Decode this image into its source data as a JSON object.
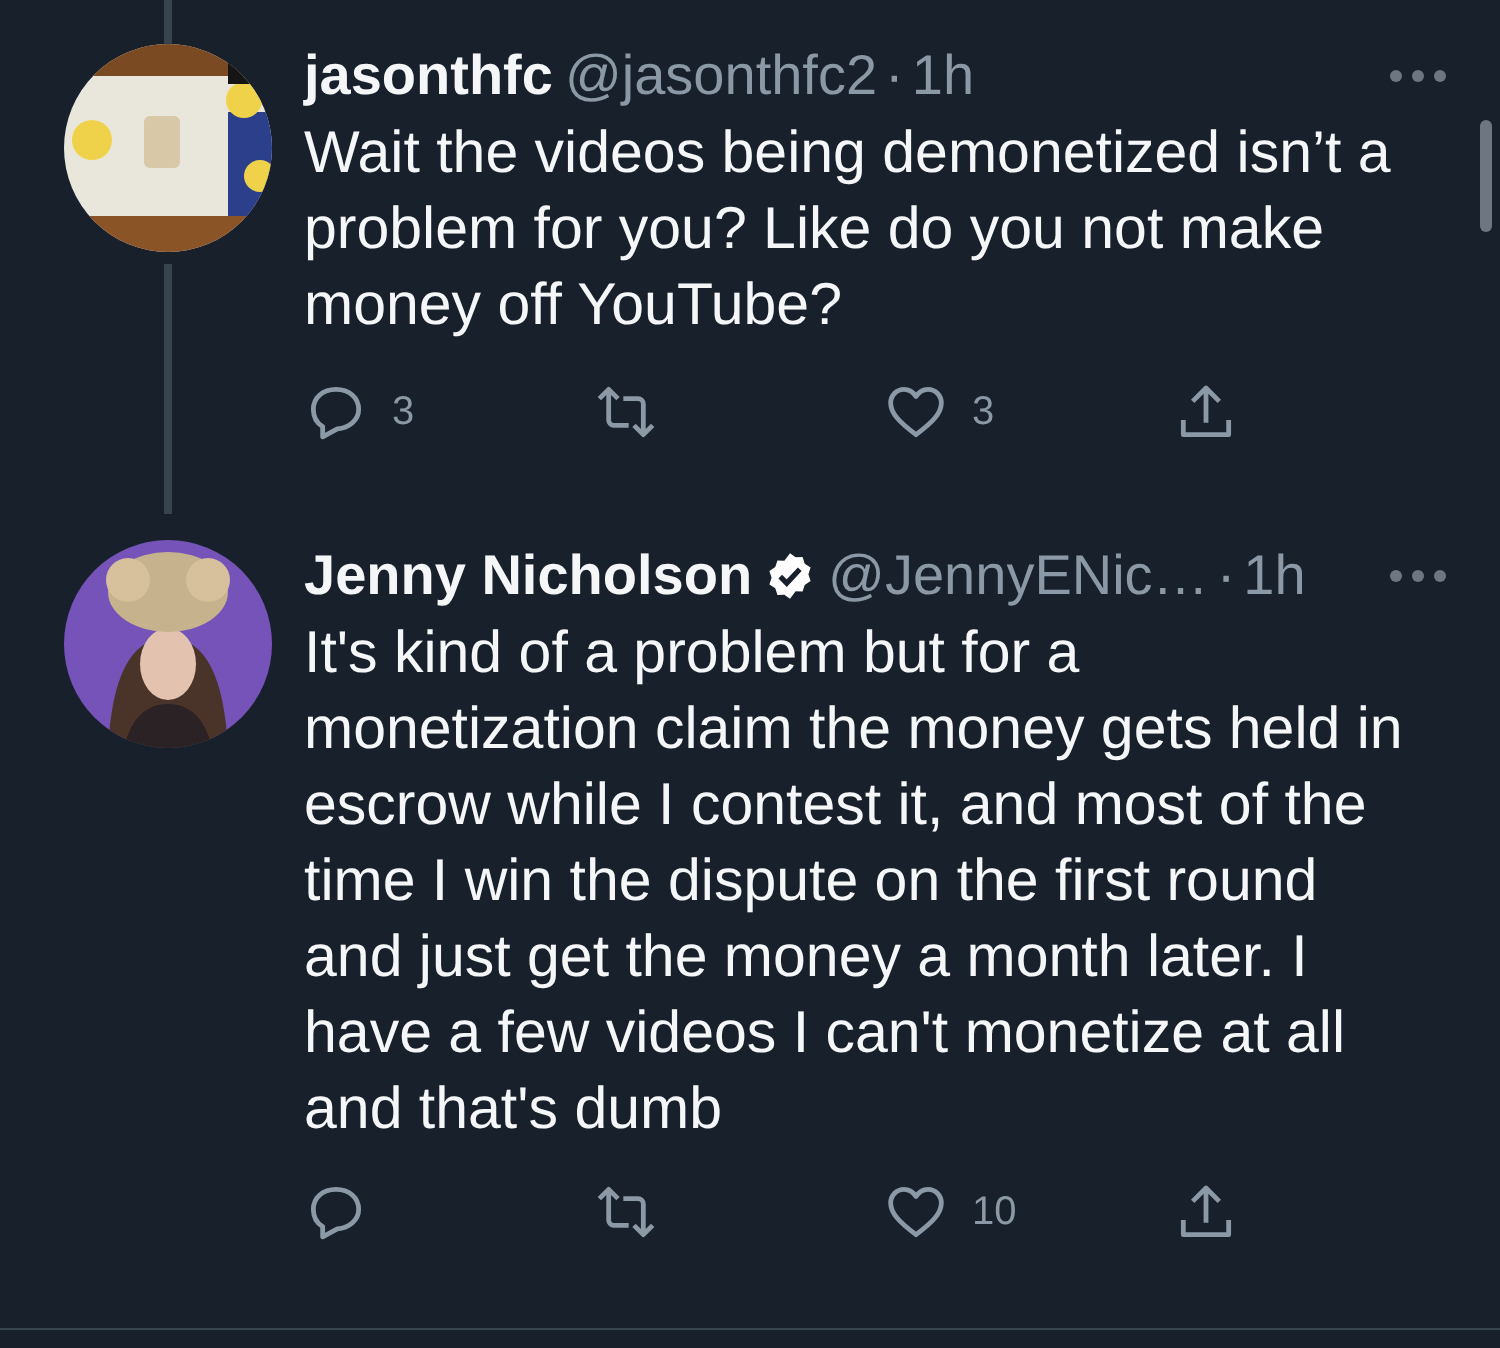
{
  "tweets": [
    {
      "name": "jasonthfc",
      "verified": false,
      "handle": "@jasonthfc2",
      "separator": "·",
      "time": "1h",
      "thread_above": true,
      "thread_below": true,
      "text": "Wait the videos being demonetized isn’t a\nproblem for you? Like do you not make\nmoney off YouTube?",
      "actions": [
        {
          "kind": "reply",
          "count": "3"
        },
        {
          "kind": "retweet"
        },
        {
          "kind": "like",
          "count": "3"
        },
        {
          "kind": "share"
        }
      ]
    },
    {
      "name": "Jenny Nicholson",
      "verified": true,
      "handle": "@JennyENic…",
      "separator": "·",
      "time": "1h",
      "thread_above": false,
      "thread_below": false,
      "text": "It's kind of a problem but for a\nmonetization claim the money gets held in\nescrow while I contest it, and most of the\ntime I win the dispute on the first round\nand just get the money a month later. I\nhave a few videos I can't monetize at all\nand that's dumb",
      "actions": [
        {
          "kind": "reply"
        },
        {
          "kind": "retweet"
        },
        {
          "kind": "like",
          "count": "10"
        },
        {
          "kind": "share"
        }
      ]
    }
  ]
}
